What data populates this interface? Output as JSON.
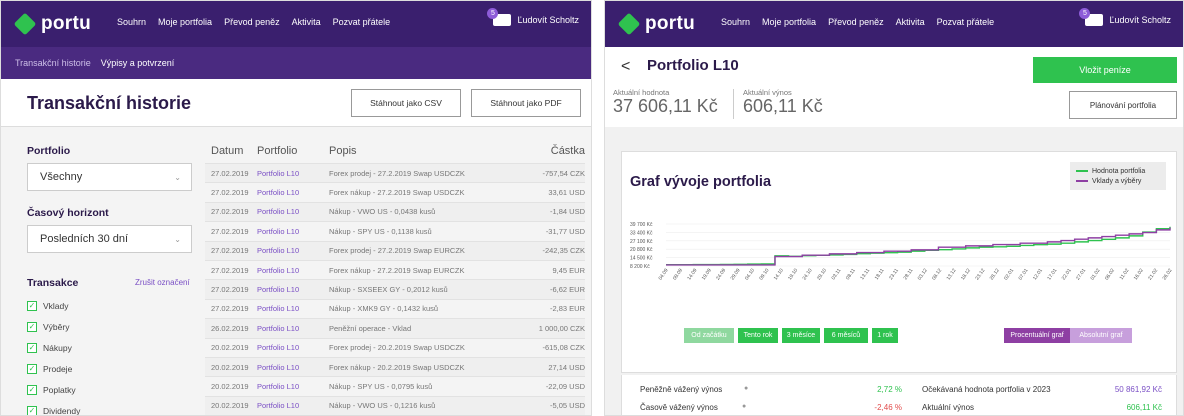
{
  "left": {
    "nav": {
      "logo": "portu",
      "items": [
        "Souhrn",
        "Moje portfolia",
        "Převod peněz",
        "Aktivita",
        "Pozvat přátele"
      ],
      "badge": "5",
      "user": "Ľudovít Scholtz"
    },
    "subnav": {
      "a": "Transakční historie",
      "b": "Výpisy a potvrzení"
    },
    "title": "Transakční historie",
    "btn_csv": "Stáhnout jako CSV",
    "btn_pdf": "Stáhnout jako PDF",
    "filter": {
      "portfolio_label": "Portfolio",
      "portfolio_value": "Všechny",
      "horizon_label": "Časový horizont",
      "horizon_value": "Posledních 30 dní",
      "tx_label": "Transakce",
      "clear": "Zrušit označení",
      "checks": [
        "Vklady",
        "Výběry",
        "Nákupy",
        "Prodeje",
        "Poplatky",
        "Dividendy"
      ]
    },
    "table": {
      "headers": [
        "Datum",
        "Portfolio",
        "Popis",
        "Částka"
      ],
      "rows": [
        [
          "27.02.2019",
          "Portfolio L10",
          "Forex prodej - 27.2.2019 Swap USDCZK",
          "-757,54 CZK"
        ],
        [
          "27.02.2019",
          "Portfolio L10",
          "Forex nákup - 27.2.2019 Swap USDCZK",
          "33,61 USD"
        ],
        [
          "27.02.2019",
          "Portfolio L10",
          "Nákup - VWO US - 0,0438 kusů",
          "-1,84 USD"
        ],
        [
          "27.02.2019",
          "Portfolio L10",
          "Nákup - SPY US - 0,1138 kusů",
          "-31,77 USD"
        ],
        [
          "27.02.2019",
          "Portfolio L10",
          "Forex prodej - 27.2.2019 Swap EURCZK",
          "-242,35 CZK"
        ],
        [
          "27.02.2019",
          "Portfolio L10",
          "Forex nákup - 27.2.2019 Swap EURCZK",
          "9,45 EUR"
        ],
        [
          "27.02.2019",
          "Portfolio L10",
          "Nákup - SXSEEX GY - 0,2012 kusů",
          "-6,62 EUR"
        ],
        [
          "27.02.2019",
          "Portfolio L10",
          "Nákup - XMK9 GY - 0,1432 kusů",
          "-2,83 EUR"
        ],
        [
          "26.02.2019",
          "Portfolio L10",
          "Peněžní operace - Vklad",
          "1 000,00 CZK"
        ],
        [
          "20.02.2019",
          "Portfolio L10",
          "Forex prodej - 20.2.2019 Swap USDCZK",
          "-615,08 CZK"
        ],
        [
          "20.02.2019",
          "Portfolio L10",
          "Forex nákup - 20.2.2019 Swap USDCZK",
          "27,14 USD"
        ],
        [
          "20.02.2019",
          "Portfolio L10",
          "Nákup - SPY US - 0,0795 kusů",
          "-22,09 USD"
        ],
        [
          "20.02.2019",
          "Portfolio L10",
          "Nákup - VWO US - 0,1216 kusů",
          "-5,05 USD"
        ]
      ]
    }
  },
  "right": {
    "nav": {
      "logo": "portu",
      "items": [
        "Souhrn",
        "Moje portfolia",
        "Převod peněz",
        "Aktivita",
        "Pozvat přátele"
      ],
      "badge": "5",
      "user": "Ľudovít Scholtz"
    },
    "back": "<",
    "title": "Portfolio L10",
    "btn_deposit": "Vložit peníze",
    "btn_plan": "Plánování portfolia",
    "kpi": {
      "value_label": "Aktuální hodnota",
      "value": "37 606,11 Kč",
      "yield_label": "Aktuální výnos",
      "yield": "606,11 Kč"
    },
    "chart_title": "Graf vývoje portfolia",
    "toggles": [
      "Od začátku",
      "Tento rok",
      "3 měsíce",
      "6 měsíců",
      "1 rok"
    ],
    "mode_toggles": [
      "Procentuální graf",
      "Absolutní graf"
    ],
    "stats": {
      "l1": "Peněžně vážený výnos",
      "v1": "2,72 %",
      "l2": "Časově vážený výnos",
      "v2": "-2,46 %",
      "l3": "Očekávaná hodnota portfolia v 2023",
      "v3": "50 861,92 Kč",
      "l4": "Aktuální výnos",
      "v4": "606,11 Kč"
    }
  },
  "colors": {
    "nav": "#3a1f6e",
    "green": "#2fc24f",
    "purple": "#7a4fc5",
    "red": "#e24b4b"
  },
  "chart_data": {
    "type": "line",
    "title": "Graf vývoje portfolia",
    "yticks": [
      "39 700 Kč",
      "33 400 Kč",
      "27 100 Kč",
      "20 800 Kč",
      "14 500 Kč",
      "8 200 Kč"
    ],
    "xticks": [
      "04.09",
      "09.09",
      "14.09",
      "19.09",
      "24.09",
      "29.09",
      "04.10",
      "09.10",
      "14.10",
      "19.10",
      "24.10",
      "29.10",
      "03.11",
      "08.11",
      "13.11",
      "18.11",
      "23.11",
      "28.11",
      "03.12",
      "08.12",
      "13.12",
      "18.12",
      "23.12",
      "28.12",
      "02.01",
      "07.01",
      "12.01",
      "17.01",
      "22.01",
      "27.01",
      "01.02",
      "06.02",
      "11.02",
      "16.02",
      "21.02",
      "26.02"
    ],
    "ylim": [
      8200,
      39700
    ],
    "series": [
      {
        "name": "Hodnota portfolia",
        "color": "#2fc24f",
        "values": [
          9200,
          9200,
          9300,
          9300,
          9400,
          9500,
          9600,
          9700,
          15800,
          15500,
          15900,
          16200,
          16500,
          16900,
          17400,
          17800,
          18200,
          18600,
          19300,
          20000,
          20400,
          21000,
          21800,
          22300,
          22600,
          23000,
          23600,
          24200,
          24600,
          25300,
          26300,
          27300,
          28200,
          29300,
          30800,
          33600,
          36200,
          37600
        ]
      },
      {
        "name": "Vklady a výběry",
        "color": "#8e3fa3",
        "values": [
          9000,
          9000,
          9000,
          9000,
          9000,
          9000,
          9000,
          9000,
          15300,
          15300,
          16300,
          16300,
          17300,
          17300,
          18300,
          18300,
          19300,
          19300,
          20300,
          20300,
          22300,
          22300,
          23300,
          23300,
          24300,
          24300,
          25300,
          25300,
          26300,
          27300,
          28300,
          29300,
          30300,
          31300,
          32300,
          33300,
          35300,
          37000
        ]
      }
    ]
  }
}
